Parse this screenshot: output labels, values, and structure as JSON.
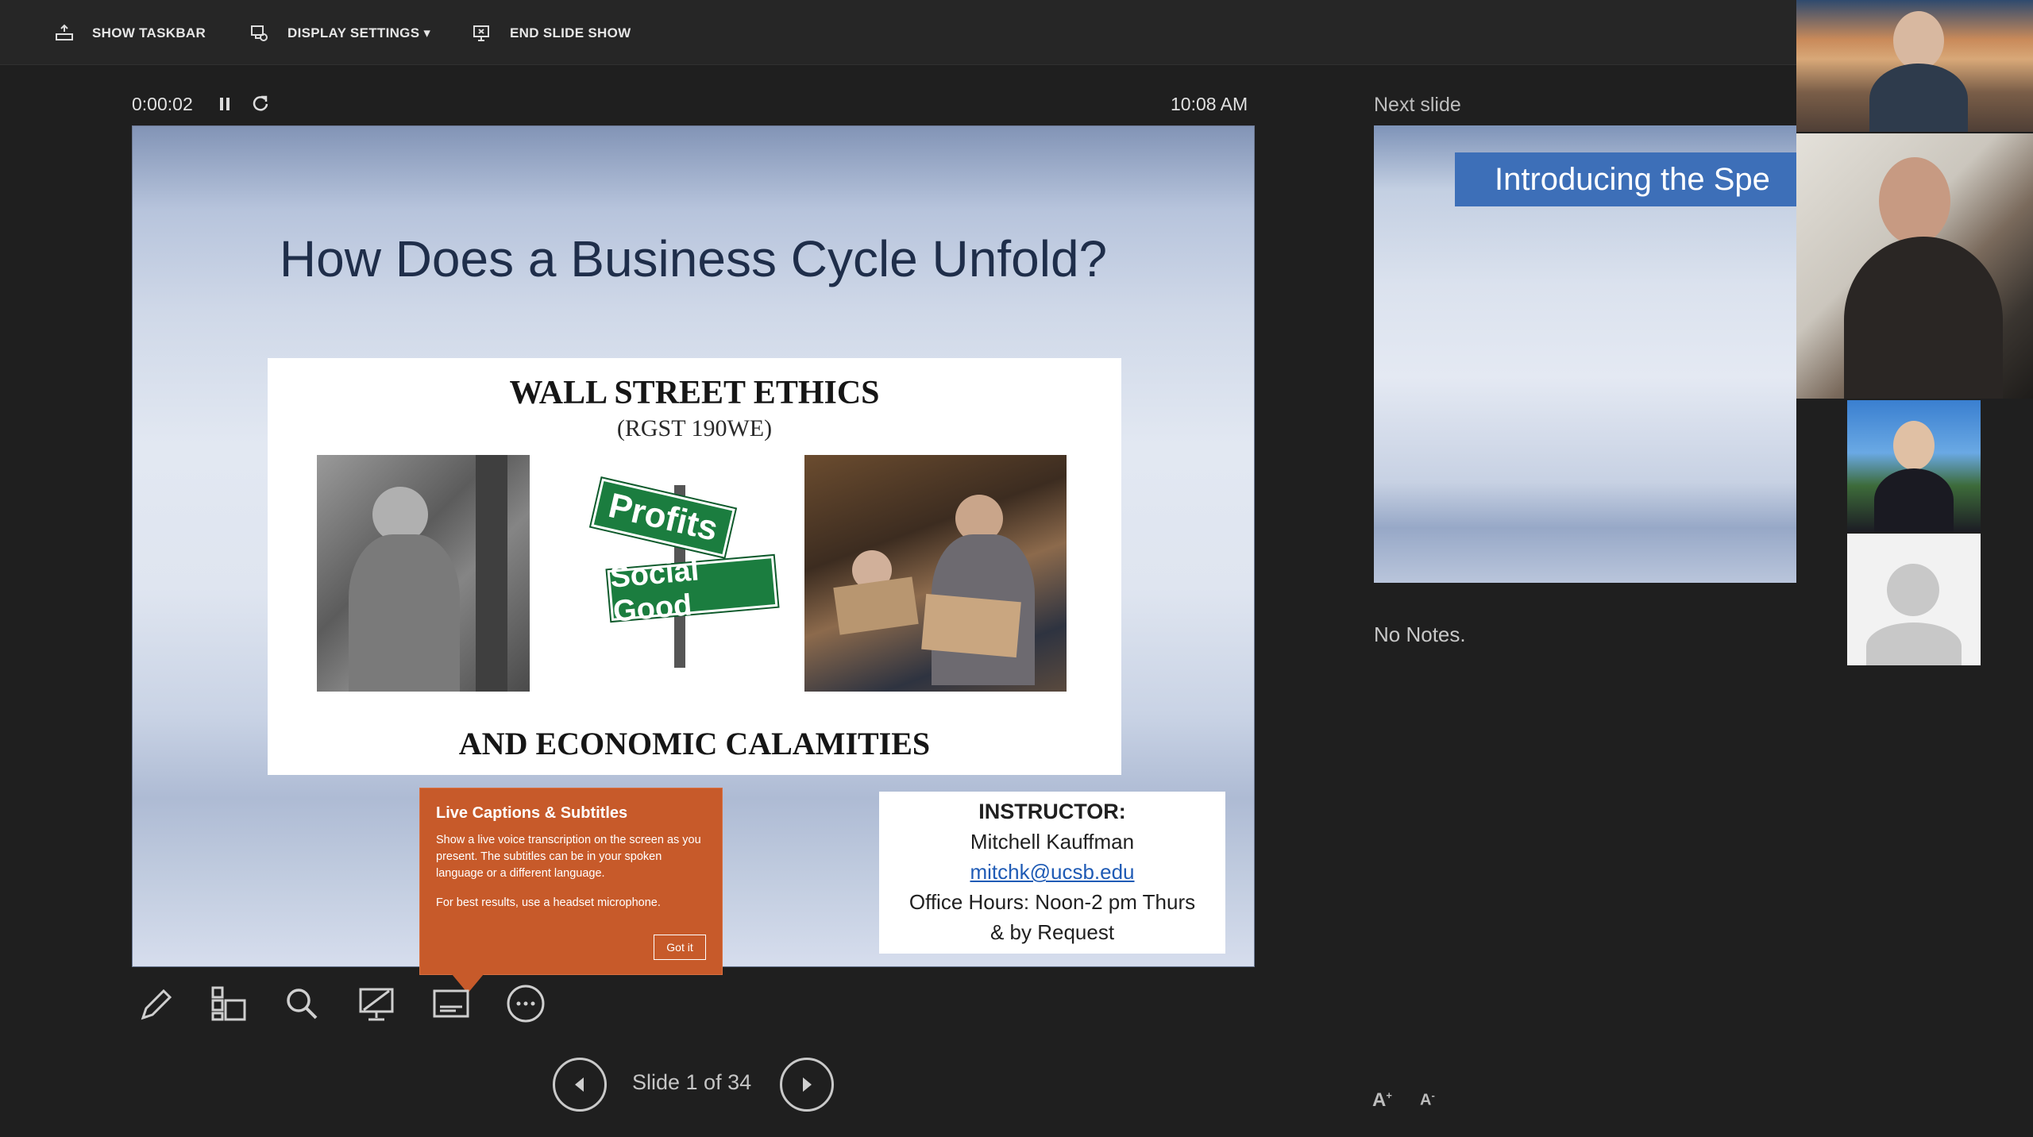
{
  "toolbar": {
    "show_taskbar": "SHOW TASKBAR",
    "display_settings": "DISPLAY SETTINGS ▾",
    "end_slide_show": "END SLIDE SHOW"
  },
  "presenter": {
    "timer": "0:00:02",
    "clock": "10:08 AM",
    "slide_counter": "Slide 1 of 34",
    "next_slide_label": "Next slide",
    "notes": "No Notes."
  },
  "slide": {
    "title": "How Does a Business Cycle Unfold?",
    "course_title": "WALL STREET ETHICS",
    "course_code": "(RGST 190WE)",
    "course_subtitle": "AND ECONOMIC CALAMITIES",
    "sign_top": "Profits",
    "sign_bottom": "Social Good",
    "instructor_label": "INSTRUCTOR:",
    "instructor_name": "Mitchell Kauffman",
    "instructor_email": "mitchk@ucsb.edu",
    "office_hours_1": "Office Hours: Noon-2 pm Thurs",
    "office_hours_2": "& by Request"
  },
  "callout": {
    "title": "Live Captions & Subtitles",
    "body": "Show a live voice transcription on the screen as you present. The subtitles can be in your spoken language or a different language.",
    "hint": "For best results, use a headset microphone.",
    "button": "Got it"
  },
  "next_slide": {
    "banner": "Introducing the Spe"
  },
  "font_controls": {
    "increase": "A",
    "decrease": "A"
  },
  "icons": [
    "taskbar-icon",
    "display-settings-icon",
    "end-show-icon",
    "pause-icon",
    "reset-icon",
    "pen-icon",
    "see-all-slides-icon",
    "zoom-icon",
    "black-screen-icon",
    "subtitles-icon",
    "more-options-icon",
    "previous-icon",
    "next-icon"
  ]
}
